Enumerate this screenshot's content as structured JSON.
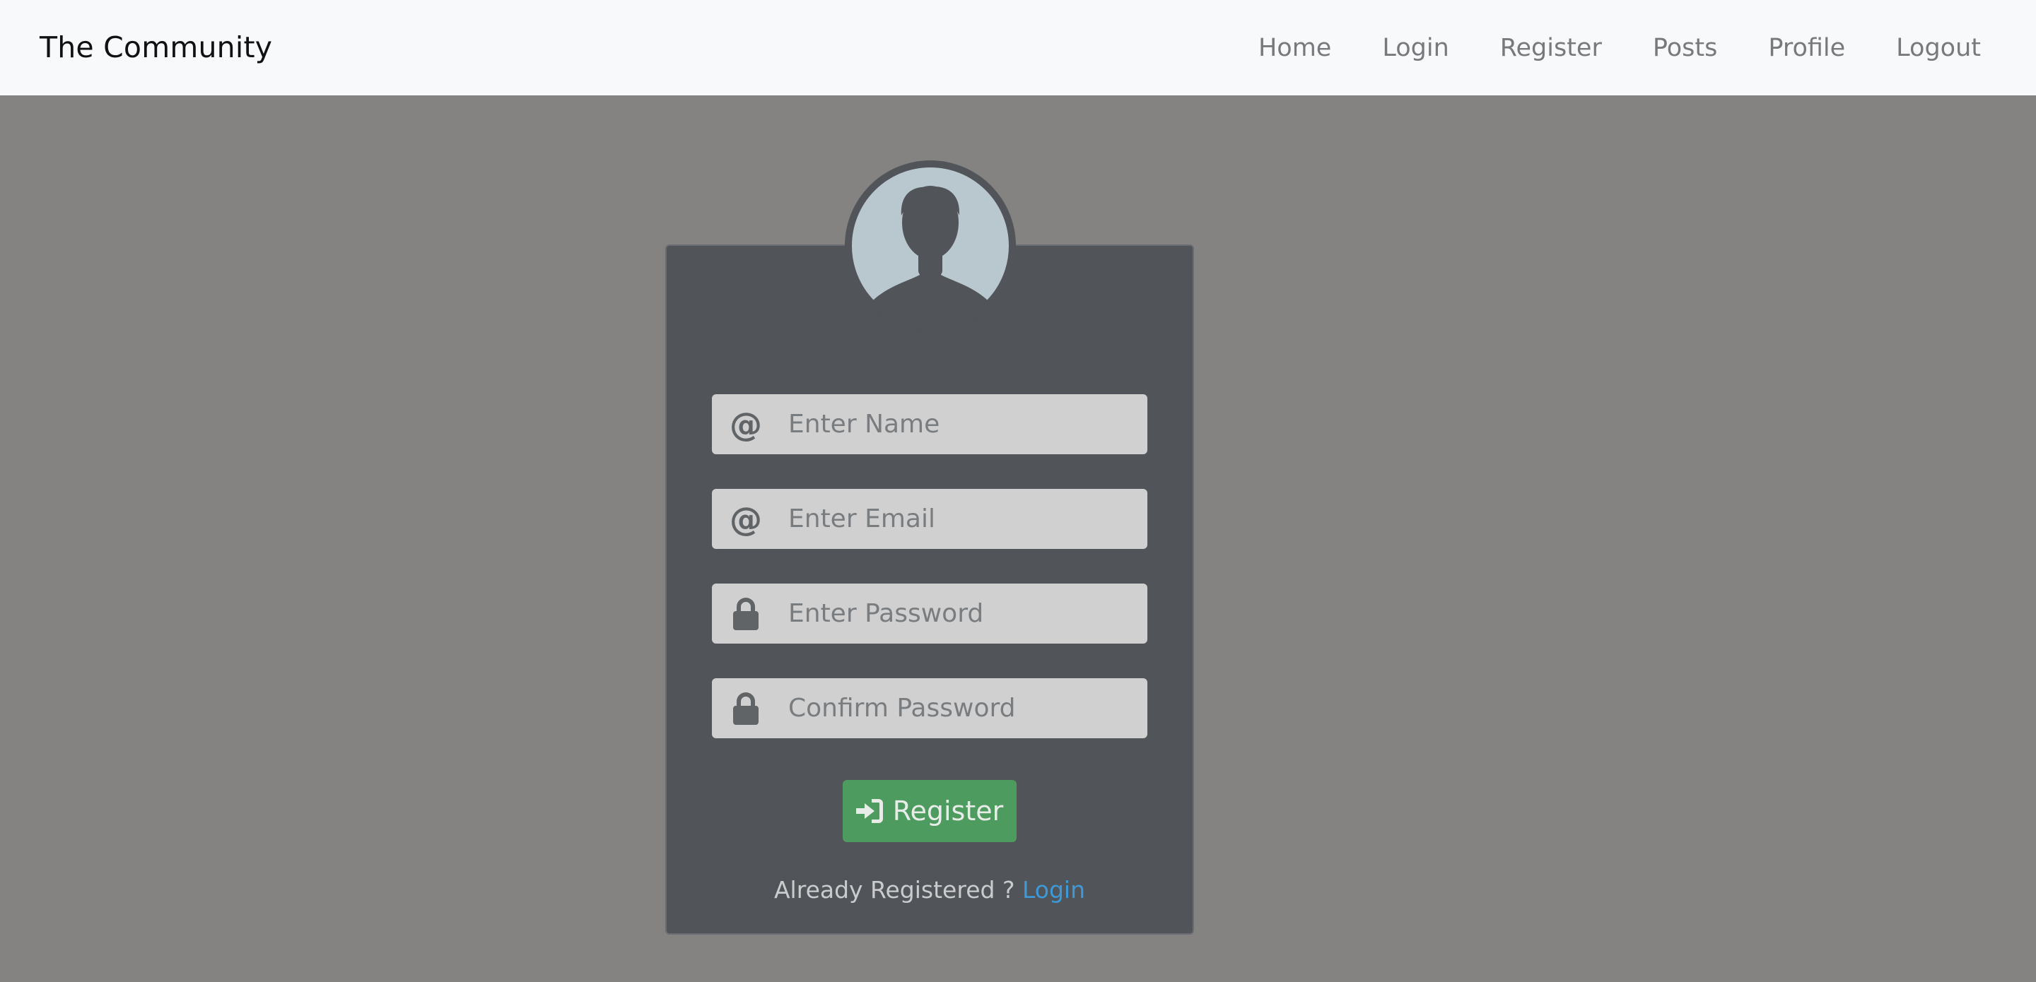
{
  "navbar": {
    "brand": "The Community",
    "links": [
      {
        "label": "Home"
      },
      {
        "label": "Login"
      },
      {
        "label": "Register"
      },
      {
        "label": "Posts"
      },
      {
        "label": "Profile"
      },
      {
        "label": "Logout"
      }
    ]
  },
  "form": {
    "fields": [
      {
        "icon": "at-icon",
        "icon_glyph": "@",
        "placeholder": "Enter Name",
        "value": ""
      },
      {
        "icon": "at-icon",
        "icon_glyph": "@",
        "placeholder": "Enter Email",
        "value": ""
      },
      {
        "icon": "lock-icon",
        "placeholder": "Enter Password",
        "value": ""
      },
      {
        "icon": "lock-icon",
        "placeholder": "Confirm Password",
        "value": ""
      }
    ],
    "submit_label": "Register",
    "submit_icon": "sign-in-icon",
    "footer_text": "Already Registered ?",
    "footer_link": "Login"
  },
  "colors": {
    "page_background": "#848381",
    "navbar_background": "#f8f9fb",
    "card_background": "#515459",
    "input_background": "#d0d0d0",
    "button_green": "#4d9b5f",
    "link_blue": "#3d9ad6",
    "avatar_background": "#b9c7cf"
  }
}
